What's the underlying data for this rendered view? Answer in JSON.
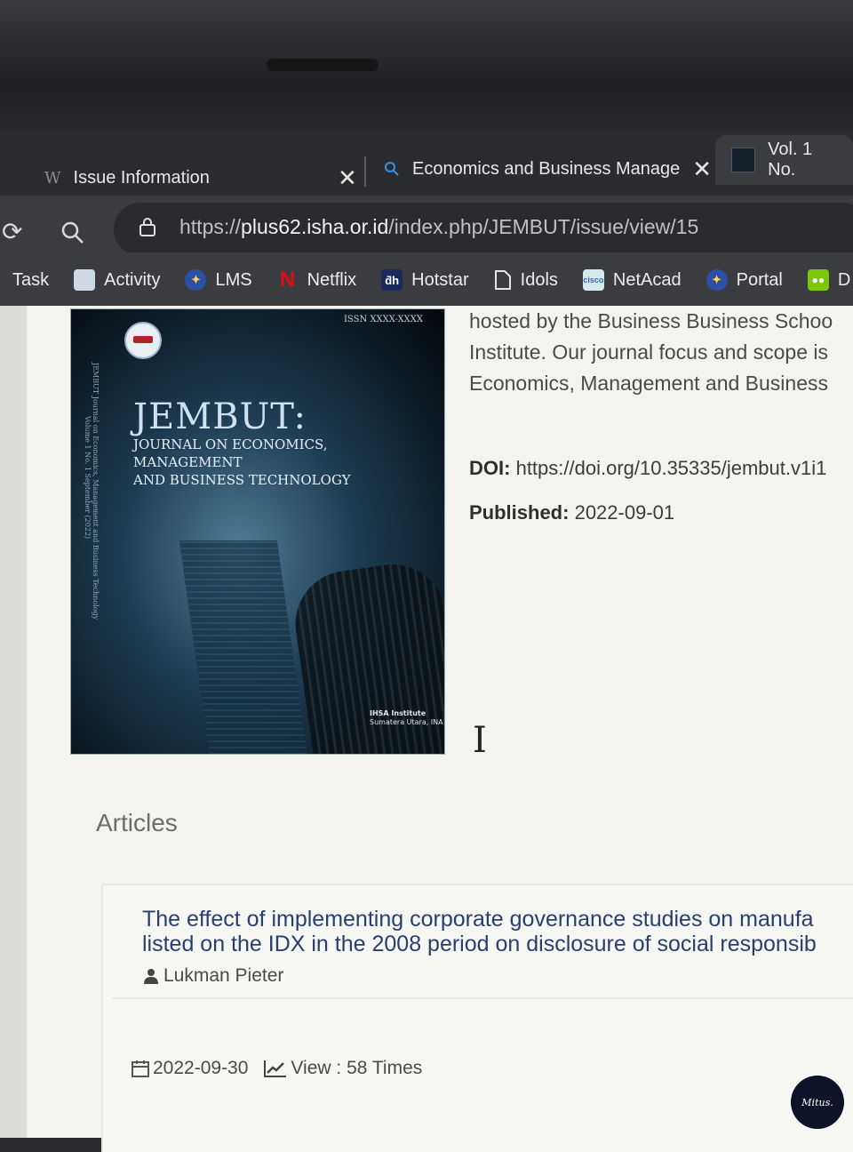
{
  "tabs": [
    {
      "favicon": "W",
      "title": "Issue Information",
      "close": "✕"
    },
    {
      "favicon": "search-icon",
      "title": "Economics and Business Manage",
      "close": "✕"
    },
    {
      "favicon": "journal-thumbnail",
      "title": "Vol. 1 No."
    }
  ],
  "address_bar": {
    "scheme": "https://",
    "host": "plus62.isha.or.id",
    "path": "/index.php/JEMBUT/issue/view/15"
  },
  "bookmarks": [
    {
      "label": "Task",
      "icon": "task-icon"
    },
    {
      "label": "Activity",
      "icon": "activity-icon"
    },
    {
      "label": "LMS",
      "icon": "lms-icon"
    },
    {
      "label": "Netflix",
      "icon": "netflix-icon"
    },
    {
      "label": "Hotstar",
      "icon": "hotstar-icon"
    },
    {
      "label": "Idols",
      "icon": "page-icon"
    },
    {
      "label": "NetAcad",
      "icon": "cisco-icon"
    },
    {
      "label": "Portal",
      "icon": "portal-icon"
    },
    {
      "label": "D",
      "icon": "duolingo-icon"
    }
  ],
  "cover": {
    "issn": "ISSN XXXX-XXXX",
    "title": "JEMBUT:",
    "subtitle_line1": "Journal on Economics, Management",
    "subtitle_line2": "and Business Technology",
    "spine_text": "JEMBUT Journal on Economics, Management and Business Technology",
    "spine_volume": "Volume 1 No. 1 September (2022)",
    "publisher_line1": "IHSA Institute",
    "publisher_line2": "Sumatera Utara, INA"
  },
  "description": {
    "line1": "hosted by the Business Business Schoo",
    "line2": "Institute. Our journal focus and scope is",
    "line3": "Economics, Management and Business"
  },
  "doi": {
    "label": "DOI:",
    "value": "https://doi.org/10.35335/jembut.v1i1"
  },
  "published": {
    "label": "Published:",
    "value": "2022-09-01"
  },
  "articles": {
    "heading": "Articles",
    "items": [
      {
        "title_line1": "The effect of implementing corporate governance studies on manufa",
        "title_line2": "listed on the IDX in the 2008 period on disclosure of social responsib",
        "author": "Lukman Pieter",
        "date": "2022-09-30",
        "views": "View : 58 Times"
      }
    ]
  },
  "watermark": "Mitus."
}
